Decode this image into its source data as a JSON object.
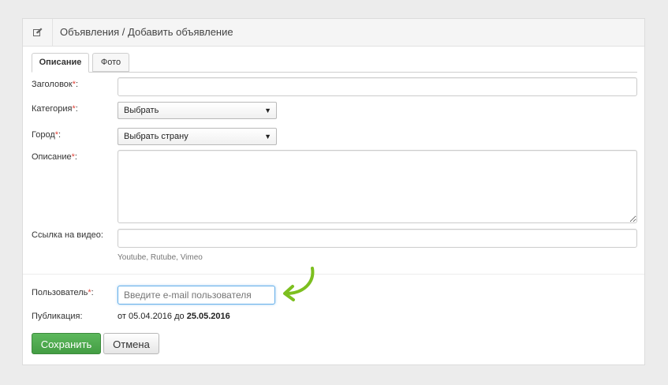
{
  "header": {
    "icon": "edit-icon",
    "title": "Объявления / Добавить объявление"
  },
  "tabs": [
    {
      "label": "Описание",
      "active": true
    },
    {
      "label": "Фото",
      "active": false
    }
  ],
  "form": {
    "title_label": "Заголовок",
    "category_label": "Категория",
    "category_value": "Выбрать",
    "city_label": "Город",
    "city_value": "Выбрать страну",
    "description_label": "Описание",
    "video_label": "Ссылка на видео:",
    "video_hint": "Youtube, Rutube, Vimeo",
    "user_label": "Пользователь",
    "user_placeholder": "Введите e-mail пользователя",
    "publication_label": "Публикация:",
    "publication_from_prefix": "от",
    "publication_from": "05.04.2016",
    "publication_to_prefix": "до",
    "publication_to": "25.05.2016",
    "required_mark": "*",
    "label_suffix": ":"
  },
  "buttons": {
    "save": "Сохранить",
    "cancel": "Отмена"
  },
  "colors": {
    "accent_green": "#5cb85c",
    "required": "#e0453a",
    "annotation_arrow": "#7cbf1f"
  }
}
